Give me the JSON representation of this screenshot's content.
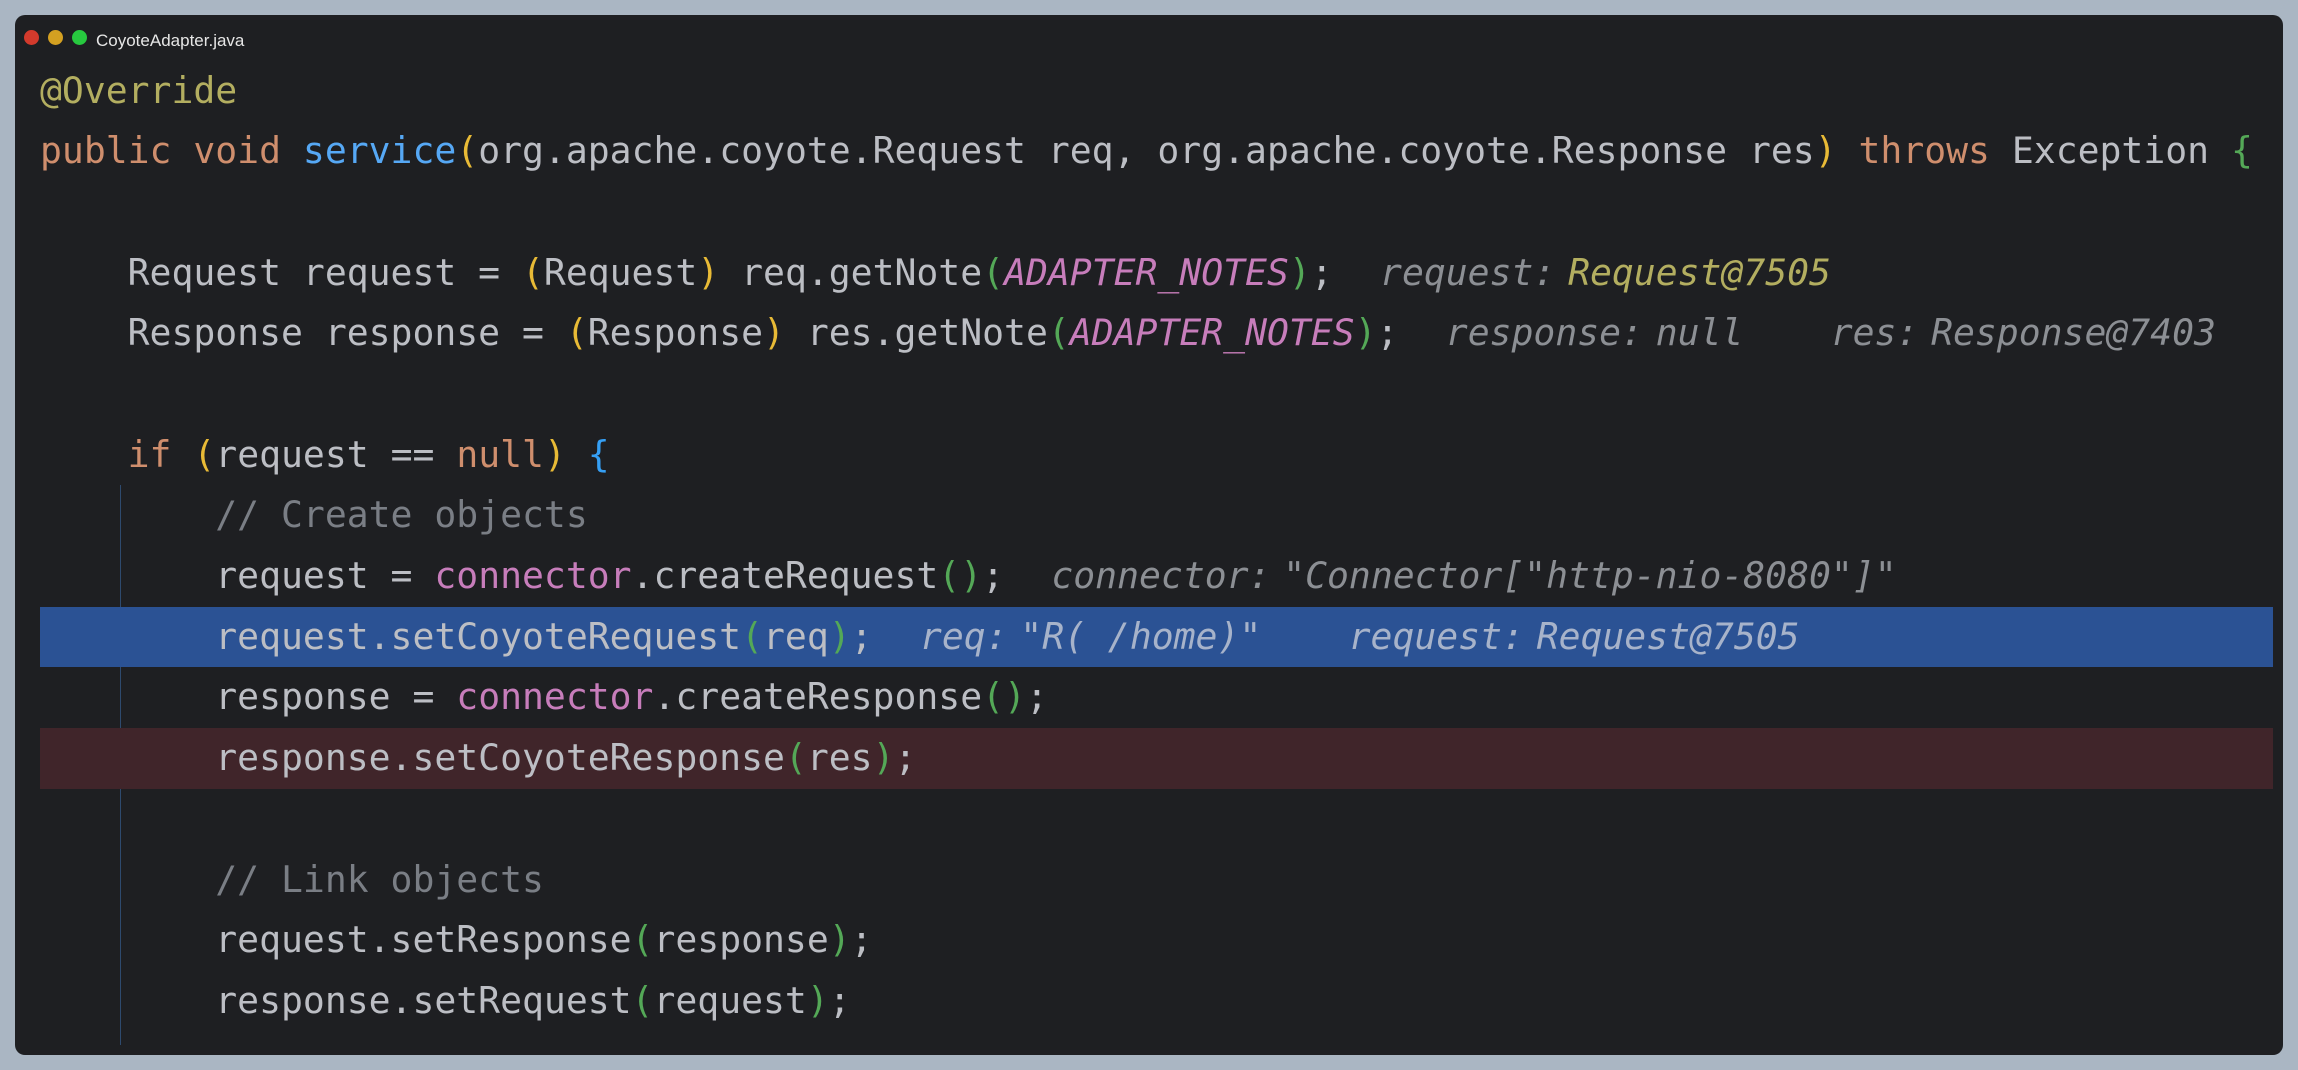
{
  "window": {
    "title": "CoyoteAdapter.java",
    "controls": [
      {
        "name": "close",
        "color": "#d33a2c"
      },
      {
        "name": "minimize",
        "color": "#d4a021"
      },
      {
        "name": "maximize",
        "color": "#27c93f"
      }
    ]
  },
  "colors": {
    "ann": "#b3ae60",
    "kw": "#cf8e6d",
    "fn": "#56a8f5",
    "txt": "#bcbec4",
    "p1": "#e8ba36",
    "p2": "#54a857",
    "p3": "#359ff4",
    "const": "#c77dbb",
    "field": "#c77dbb",
    "comment": "#7a7e85",
    "hintval": "#8c8f94",
    "hintyellow": "#b3ae60"
  },
  "lines": [
    {
      "tokens": [
        {
          "t": "@Override",
          "c": "ann"
        }
      ]
    },
    {
      "tokens": [
        {
          "t": "public void ",
          "c": "kw"
        },
        {
          "t": "service",
          "c": "fn"
        },
        {
          "t": "(",
          "c": "p1"
        },
        {
          "t": "org.apache.coyote.Request req, org.apache.coyote.Response res",
          "c": "txt"
        },
        {
          "t": ")",
          "c": "p1"
        },
        {
          "t": " throws ",
          "c": "kw"
        },
        {
          "t": "Exception ",
          "c": "txt"
        },
        {
          "t": "{",
          "c": "p2"
        }
      ]
    },
    {
      "tokens": []
    },
    {
      "tokens": [
        {
          "t": "    Request request = ",
          "c": "txt"
        },
        {
          "t": "(",
          "c": "p1"
        },
        {
          "t": "Request",
          "c": "txt"
        },
        {
          "t": ")",
          "c": "p1"
        },
        {
          "t": " req.getNote",
          "c": "txt"
        },
        {
          "t": "(",
          "c": "p2"
        },
        {
          "t": "ADAPTER_NOTES",
          "c": "const"
        },
        {
          "t": ")",
          "c": "p2"
        },
        {
          "t": ";",
          "c": "txt"
        }
      ],
      "hints": [
        {
          "label": "request:",
          "value": "Request@7505",
          "vc": "hintyellow"
        }
      ]
    },
    {
      "tokens": [
        {
          "t": "    Response response = ",
          "c": "txt"
        },
        {
          "t": "(",
          "c": "p1"
        },
        {
          "t": "Response",
          "c": "txt"
        },
        {
          "t": ")",
          "c": "p1"
        },
        {
          "t": " res.getNote",
          "c": "txt"
        },
        {
          "t": "(",
          "c": "p2"
        },
        {
          "t": "ADAPTER_NOTES",
          "c": "const"
        },
        {
          "t": ")",
          "c": "p2"
        },
        {
          "t": ";",
          "c": "txt"
        }
      ],
      "hints": [
        {
          "label": "response:",
          "value": "null"
        },
        {
          "label": "res:",
          "value": "Response@7403"
        }
      ]
    },
    {
      "tokens": []
    },
    {
      "tokens": [
        {
          "t": "    if ",
          "c": "kw"
        },
        {
          "t": "(",
          "c": "p1"
        },
        {
          "t": "request ",
          "c": "txt"
        },
        {
          "t": "==",
          "c": "txt"
        },
        {
          "t": " null",
          "c": "kw"
        },
        {
          "t": ")",
          "c": "p1"
        },
        {
          "t": " ",
          "c": "txt"
        },
        {
          "t": "{",
          "c": "p3"
        }
      ]
    },
    {
      "tokens": [
        {
          "t": "        // Create objects",
          "c": "comment"
        }
      ]
    },
    {
      "tokens": [
        {
          "t": "        request = ",
          "c": "txt"
        },
        {
          "t": "connector",
          "c": "field"
        },
        {
          "t": ".createRequest",
          "c": "txt"
        },
        {
          "t": "()",
          "c": "p2"
        },
        {
          "t": ";",
          "c": "txt"
        }
      ],
      "hints": [
        {
          "label": "connector:",
          "value": "\"Connector[\"http-nio-8080\"]\""
        }
      ]
    },
    {
      "highlight": "blue",
      "tokens": [
        {
          "t": "        request.setCoyoteRequest",
          "c": "txt"
        },
        {
          "t": "(",
          "c": "p2"
        },
        {
          "t": "req",
          "c": "txt"
        },
        {
          "t": ")",
          "c": "p2"
        },
        {
          "t": ";",
          "c": "txt"
        }
      ],
      "hints": [
        {
          "label": "req:",
          "value": "\"R( /home)\""
        },
        {
          "label": "request:",
          "value": "Request@7505"
        }
      ]
    },
    {
      "tokens": [
        {
          "t": "        response = ",
          "c": "txt"
        },
        {
          "t": "connector",
          "c": "field"
        },
        {
          "t": ".createResponse",
          "c": "txt"
        },
        {
          "t": "()",
          "c": "p2"
        },
        {
          "t": ";",
          "c": "txt"
        }
      ]
    },
    {
      "highlight": "red",
      "tokens": [
        {
          "t": "        response.setCoyoteResponse",
          "c": "txt"
        },
        {
          "t": "(",
          "c": "p2"
        },
        {
          "t": "res",
          "c": "txt"
        },
        {
          "t": ")",
          "c": "p2"
        },
        {
          "t": ";",
          "c": "txt"
        }
      ]
    },
    {
      "tokens": []
    },
    {
      "tokens": [
        {
          "t": "        // Link objects",
          "c": "comment"
        }
      ]
    },
    {
      "tokens": [
        {
          "t": "        request.setResponse",
          "c": "txt"
        },
        {
          "t": "(",
          "c": "p2"
        },
        {
          "t": "response",
          "c": "txt"
        },
        {
          "t": ")",
          "c": "p2"
        },
        {
          "t": ";",
          "c": "txt"
        }
      ]
    },
    {
      "tokens": [
        {
          "t": "        response.setRequest",
          "c": "txt"
        },
        {
          "t": "(",
          "c": "p2"
        },
        {
          "t": "request",
          "c": "txt"
        },
        {
          "t": ")",
          "c": "p2"
        },
        {
          "t": ";",
          "c": "txt"
        }
      ]
    }
  ]
}
